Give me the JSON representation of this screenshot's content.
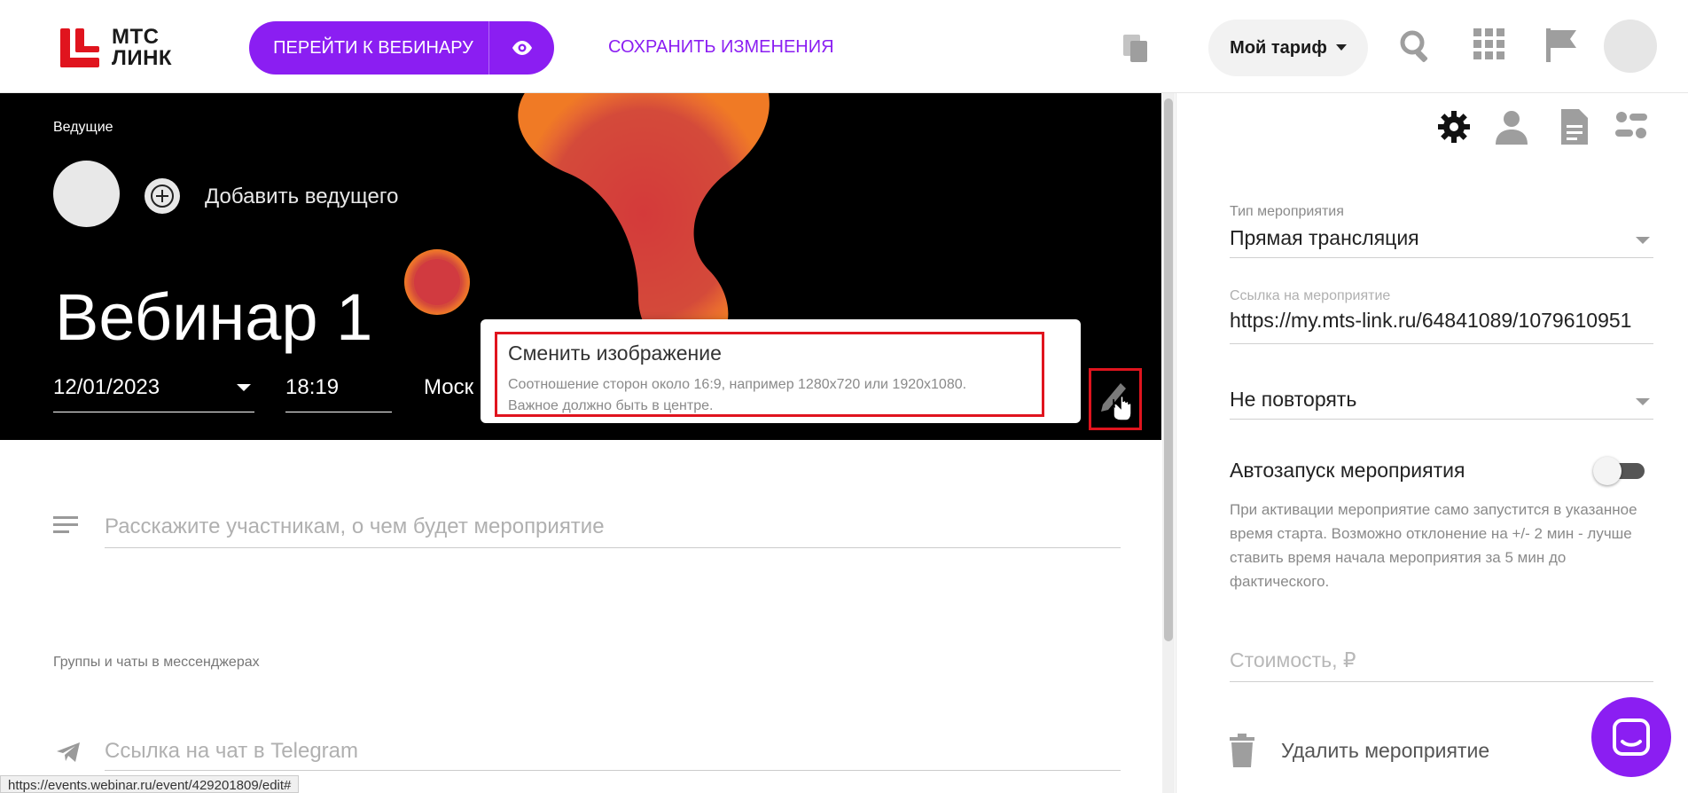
{
  "header": {
    "logo_line1": "МТС",
    "logo_line2": "ЛИНК",
    "webinar_button": "ПЕРЕЙТИ К ВЕБИНАРУ",
    "save_link": "СОХРАНИТЬ ИЗМЕНЕНИЯ",
    "tariff": "Мой тариф",
    "icons": [
      "copy-icon",
      "search-icon",
      "apps-grid-icon",
      "flag-icon",
      "user-avatar"
    ]
  },
  "event": {
    "hosts_label": "Ведущие",
    "add_host": "Добавить ведущего",
    "title": "Вебинар 1",
    "date": "12/01/2023",
    "time": "18:19",
    "timezone": "Моск"
  },
  "tooltip": {
    "title": "Сменить изображение",
    "line1": "Соотношение сторон около 16:9, например 1280x720 или 1920x1080.",
    "line2": "Важное должно быть в центре."
  },
  "body": {
    "description_placeholder": "Расскажите участникам, о чем будет мероприятие",
    "groups_label": "Группы и чаты в мессенджерах",
    "telegram_placeholder": "Ссылка на чат в Telegram",
    "status_url": "https://events.webinar.ru/event/429201809/edit#"
  },
  "settings": {
    "tabs": [
      "gear-icon",
      "person-icon",
      "document-icon",
      "options-icon"
    ],
    "event_type_label": "Тип мероприятия",
    "event_type_value": "Прямая трансляция",
    "link_label": "Ссылка на мероприятие",
    "link_value": "https://my.mts-link.ru/64841089/1079610951",
    "repeat_value": "Не повторять",
    "autostart_label": "Автозапуск мероприятия",
    "autostart_on": false,
    "autostart_desc": "При активации мероприятие само запустится в указанное время старта. Возможно отклонение на +/- 2 мин - лучше ставить время начала мероприятия за 5 мин до фактического.",
    "cost_placeholder": "Стоимость, ₽",
    "delete_label": "Удалить мероприятие"
  },
  "colors": {
    "brand_purple": "#8b1ef2",
    "highlight_red": "#e0141e",
    "hero_bg": "#000000"
  }
}
